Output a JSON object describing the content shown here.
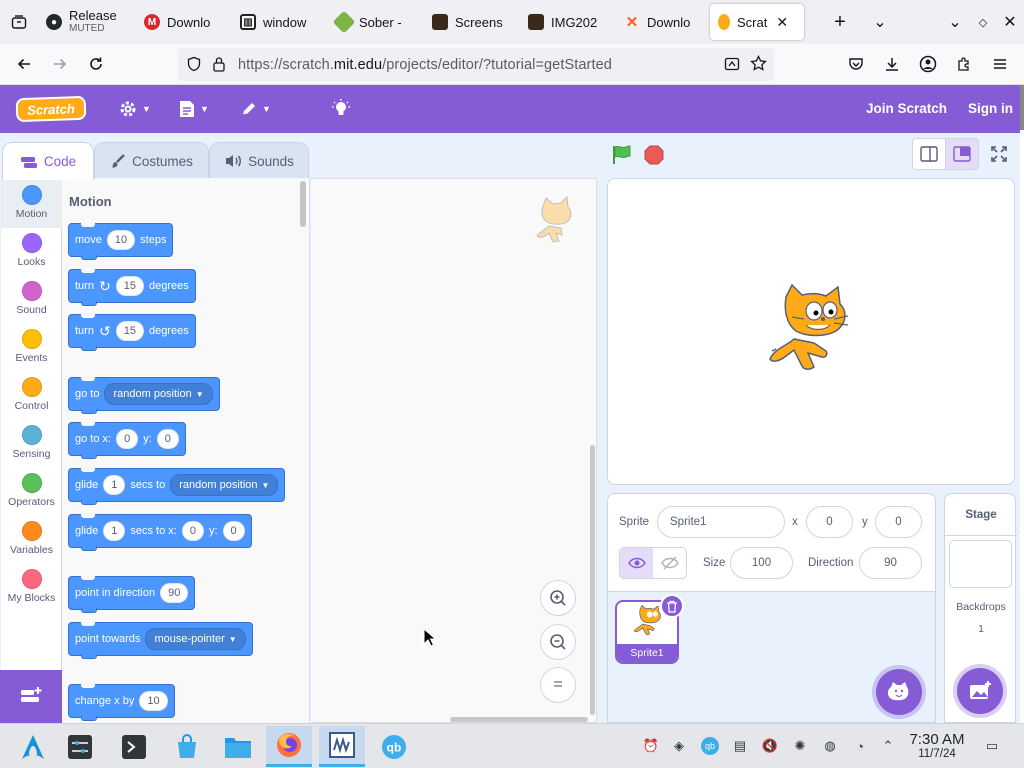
{
  "browser": {
    "tabs": [
      {
        "title": "Release",
        "subtitle": "MUTED",
        "icon": "github-icon",
        "color": "#24292f"
      },
      {
        "title": "Downlo",
        "icon": "mega-icon",
        "color": "#d9272e"
      },
      {
        "title": "window",
        "icon": "window-icon",
        "color": "#222222"
      },
      {
        "title": "Sober -",
        "icon": "sober-icon",
        "color": "#7cb342"
      },
      {
        "title": "Screens",
        "icon": "screens-icon",
        "color": "#3a2a1a"
      },
      {
        "title": "IMG202",
        "icon": "img-icon",
        "color": "#3a2a1a"
      },
      {
        "title": "Downlo",
        "icon": "x-brand-icon",
        "color": "#ff5a1f"
      },
      {
        "title": "Scrat",
        "icon": "scratch-icon",
        "color": "#ffab19",
        "active": true
      }
    ],
    "url_prefix": "https://scratch.",
    "url_domain": "mit.edu",
    "url_path": "/projects/editor/?tutorial=getStarted"
  },
  "menubar": {
    "logo": "Scratch",
    "join": "Join Scratch",
    "signin": "Sign in"
  },
  "editor_tabs": {
    "code": "Code",
    "costumes": "Costumes",
    "sounds": "Sounds"
  },
  "categories": [
    {
      "label": "Motion",
      "color": "#4c97ff"
    },
    {
      "label": "Looks",
      "color": "#9966ff"
    },
    {
      "label": "Sound",
      "color": "#cf63cf"
    },
    {
      "label": "Events",
      "color": "#ffbf00"
    },
    {
      "label": "Control",
      "color": "#ffab19"
    },
    {
      "label": "Sensing",
      "color": "#5cb1d6"
    },
    {
      "label": "Operators",
      "color": "#59c059"
    },
    {
      "label": "Variables",
      "color": "#ff8c1a"
    },
    {
      "label": "My Blocks",
      "color": "#ff6680"
    }
  ],
  "flyout": {
    "title": "Motion",
    "move": {
      "a": "move",
      "v": "10",
      "b": "steps"
    },
    "turn_right": {
      "a": "turn",
      "v": "15",
      "b": "degrees"
    },
    "turn_left": {
      "a": "turn",
      "v": "15",
      "b": "degrees"
    },
    "goto": {
      "a": "go to",
      "dd": "random position"
    },
    "goto_xy": {
      "a": "go to x:",
      "x": "0",
      "b": "y:",
      "y": "0"
    },
    "glide": {
      "a": "glide",
      "v": "1",
      "b": "secs to",
      "dd": "random position"
    },
    "glide_xy": {
      "a": "glide",
      "v": "1",
      "b": "secs to x:",
      "x": "0",
      "c": "y:",
      "y": "0"
    },
    "point_dir": {
      "a": "point in direction",
      "v": "90"
    },
    "point_towards": {
      "a": "point towards",
      "dd": "mouse-pointer"
    },
    "change_x": {
      "a": "change x by",
      "v": "10"
    }
  },
  "sprite_info": {
    "sprite_label": "Sprite",
    "sprite_name": "Sprite1",
    "x_label": "x",
    "x": "0",
    "y_label": "y",
    "y": "0",
    "size_label": "Size",
    "size": "100",
    "direction_label": "Direction",
    "direction": "90"
  },
  "sprites": [
    {
      "name": "Sprite1"
    }
  ],
  "stage_pane": {
    "title": "Stage",
    "backdrops_label": "Backdrops",
    "backdrops_count": "1"
  },
  "taskbar": {
    "time": "7:30 AM",
    "date": "11/7/24"
  }
}
